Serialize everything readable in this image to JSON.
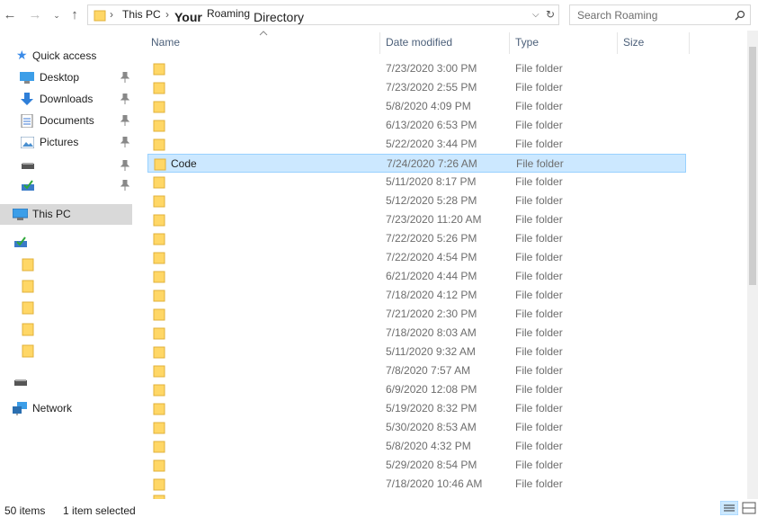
{
  "address": {
    "crumbs": [
      "This PC",
      "Your",
      "Roaming",
      "Directory"
    ]
  },
  "search": {
    "placeholder": "Search Roaming"
  },
  "nav": {
    "quick_access": "Quick access",
    "items": [
      {
        "label": "Desktop",
        "icon": "desktop-icon"
      },
      {
        "label": "Downloads",
        "icon": "downloads-icon"
      },
      {
        "label": "Documents",
        "icon": "documents-icon"
      },
      {
        "label": "Pictures",
        "icon": "pictures-icon"
      }
    ],
    "this_pc": "This PC",
    "network": "Network"
  },
  "columns": {
    "name": "Name",
    "date": "Date modified",
    "type": "Type",
    "size": "Size"
  },
  "rows": [
    {
      "name": "",
      "date": "7/23/2020 3:00 PM",
      "type": "File folder"
    },
    {
      "name": "",
      "date": "7/23/2020 2:55 PM",
      "type": "File folder"
    },
    {
      "name": "",
      "date": "5/8/2020 4:09 PM",
      "type": "File folder"
    },
    {
      "name": "",
      "date": "6/13/2020 6:53 PM",
      "type": "File folder"
    },
    {
      "name": "",
      "date": "5/22/2020 3:44 PM",
      "type": "File folder"
    },
    {
      "name": "Code",
      "date": "7/24/2020 7:26 AM",
      "type": "File folder"
    },
    {
      "name": "",
      "date": "5/11/2020 8:17 PM",
      "type": "File folder"
    },
    {
      "name": "",
      "date": "5/12/2020 5:28 PM",
      "type": "File folder"
    },
    {
      "name": "",
      "date": "7/23/2020 11:20 AM",
      "type": "File folder"
    },
    {
      "name": "",
      "date": "7/22/2020 5:26 PM",
      "type": "File folder"
    },
    {
      "name": "",
      "date": "7/22/2020 4:54 PM",
      "type": "File folder"
    },
    {
      "name": "",
      "date": "6/21/2020 4:44 PM",
      "type": "File folder"
    },
    {
      "name": "",
      "date": "7/18/2020 4:12 PM",
      "type": "File folder"
    },
    {
      "name": "",
      "date": "7/21/2020 2:30 PM",
      "type": "File folder"
    },
    {
      "name": "",
      "date": "7/18/2020 8:03 AM",
      "type": "File folder"
    },
    {
      "name": "",
      "date": "5/11/2020 9:32 AM",
      "type": "File folder"
    },
    {
      "name": "",
      "date": "7/8/2020 7:57 AM",
      "type": "File folder"
    },
    {
      "name": "",
      "date": "6/9/2020 12:08 PM",
      "type": "File folder"
    },
    {
      "name": "",
      "date": "5/19/2020 8:32 PM",
      "type": "File folder"
    },
    {
      "name": "",
      "date": "5/30/2020 8:53 AM",
      "type": "File folder"
    },
    {
      "name": "",
      "date": "5/8/2020 4:32 PM",
      "type": "File folder"
    },
    {
      "name": "",
      "date": "5/29/2020 8:54 PM",
      "type": "File folder"
    },
    {
      "name": "",
      "date": "7/18/2020 10:46 AM",
      "type": "File folder"
    }
  ],
  "status": {
    "count": "50 items",
    "selected": "1 item selected"
  }
}
